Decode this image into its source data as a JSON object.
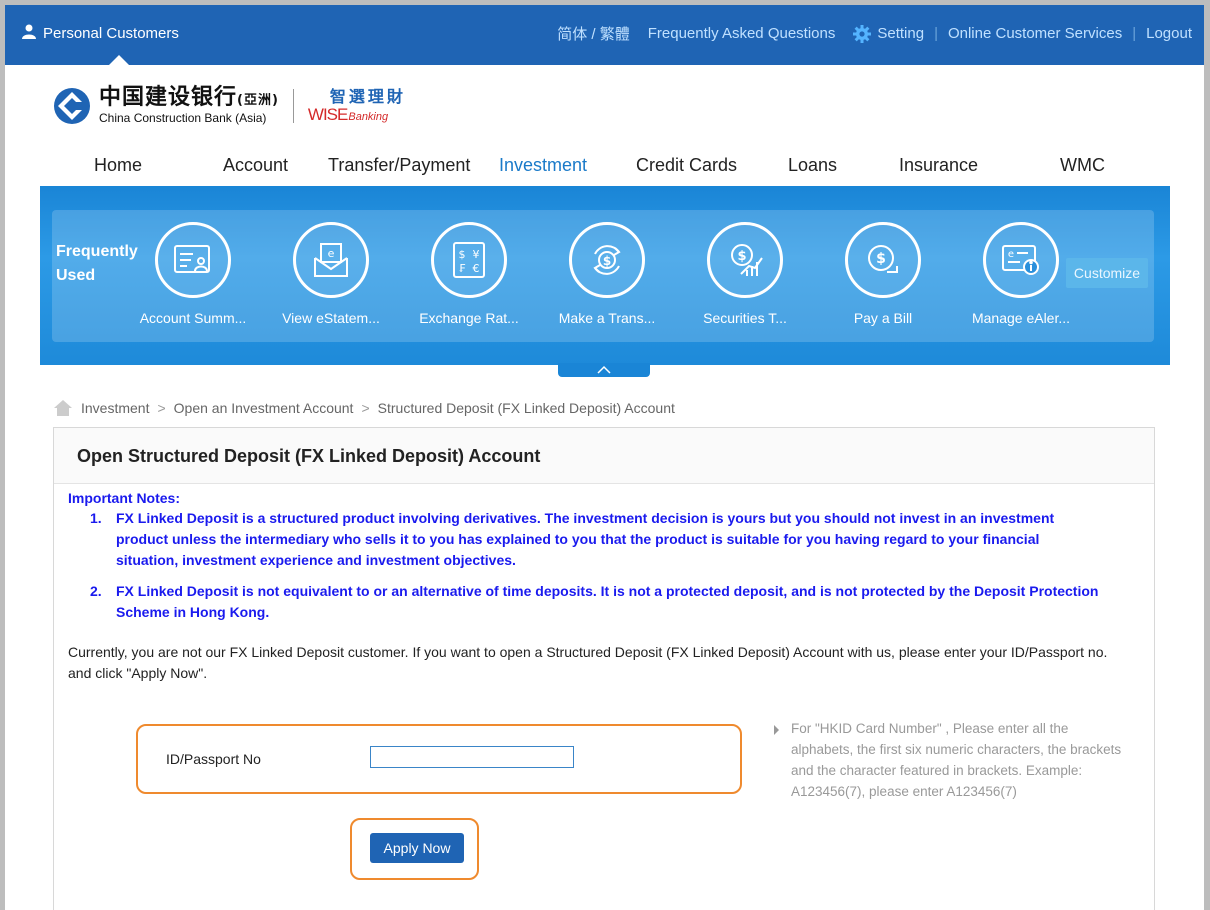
{
  "topbar": {
    "personal": "Personal Customers",
    "lang": "简体 / 繁體",
    "faq": "Frequently Asked Questions",
    "setting": "Setting",
    "online": "Online Customer Services",
    "logout": "Logout"
  },
  "logo": {
    "cn": "中国建设银行",
    "cn_suffix": "(亞洲)",
    "en": "China Construction Bank (Asia)",
    "wise_cn": "智選理財",
    "wise_en": "WISE",
    "wise_sub": "Banking"
  },
  "nav": [
    "Home",
    "Account",
    "Transfer/Payment",
    "Investment",
    "Credit Cards",
    "Loans",
    "Insurance",
    "WMC"
  ],
  "frequently_used": {
    "title": "Frequently Used",
    "items": [
      {
        "label": "Account Summ...",
        "icon": "account-summary-icon"
      },
      {
        "label": "View eStatem...",
        "icon": "estatement-icon"
      },
      {
        "label": "Exchange Rat...",
        "icon": "exchange-rate-icon"
      },
      {
        "label": "Make a Trans...",
        "icon": "transfer-icon"
      },
      {
        "label": "Securities T...",
        "icon": "securities-icon"
      },
      {
        "label": "Pay a Bill",
        "icon": "pay-bill-icon"
      },
      {
        "label": "Manage eAler...",
        "icon": "ealert-icon"
      }
    ],
    "customize": "Customize"
  },
  "breadcrumb": [
    "Investment",
    "Open an Investment Account",
    "Structured Deposit (FX Linked Deposit) Account"
  ],
  "panel": {
    "title": "Open Structured Deposit (FX Linked Deposit) Account",
    "notes_title": "Important Notes:",
    "notes": [
      {
        "num": "1.",
        "text": "FX Linked Deposit is a structured product involving derivatives. The investment decision is yours but you should not invest in an investment product unless the intermediary who sells it to you has explained to you that the product is suitable for you having regard to your financial situation, investment experience and investment objectives."
      },
      {
        "num": "2.",
        "text": "FX Linked Deposit is not equivalent to or an alternative of time deposits. It is not a protected deposit, and is not protected by the Deposit Protection Scheme in Hong Kong."
      }
    ],
    "current": "Currently, you are not our FX Linked Deposit customer. If you want to open a Structured Deposit (FX Linked Deposit) Account with us, please enter your ID/Passport no. and click \"Apply Now\".",
    "id_label": "ID/Passport No",
    "id_value": "",
    "hint": "For \"HKID Card Number\" , Please enter all the alphabets, the first six numeric characters, the brackets and the character featured in brackets. Example: A123456(7), please enter A123456(7)",
    "apply": "Apply Now"
  },
  "colors": {
    "topbar": "#1f64b4",
    "accent": "#1a7ac9",
    "notes": "#1a1aee",
    "highlight": "#ef8a2e"
  }
}
